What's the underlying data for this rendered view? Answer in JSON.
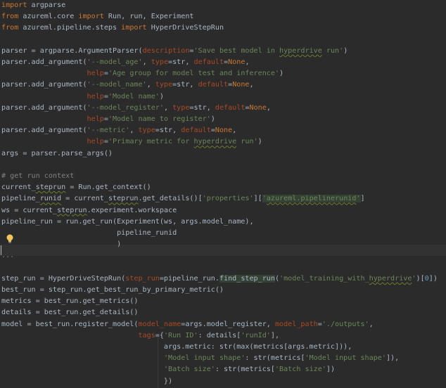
{
  "editor": {
    "lines": [
      [
        {
          "t": "import",
          "c": "kw"
        },
        {
          "t": " argparse",
          "c": "plain"
        }
      ],
      [
        {
          "t": "from",
          "c": "kw"
        },
        {
          "t": " azureml.core ",
          "c": "plain"
        },
        {
          "t": "import",
          "c": "kw"
        },
        {
          "t": " Run, run, Experiment",
          "c": "plain"
        }
      ],
      [
        {
          "t": "from",
          "c": "kw"
        },
        {
          "t": " azureml.pipeline.steps ",
          "c": "plain"
        },
        {
          "t": "import",
          "c": "kw"
        },
        {
          "t": " HyperDriveStepRun",
          "c": "plain"
        }
      ],
      [],
      [
        {
          "t": "parser = argparse.ArgumentParser(",
          "c": "plain"
        },
        {
          "t": "description",
          "c": "param"
        },
        {
          "t": "=",
          "c": "plain"
        },
        {
          "t": "'Save best model in ",
          "c": "str"
        },
        {
          "t": "hyperdrive",
          "c": "str squig"
        },
        {
          "t": " run'",
          "c": "str"
        },
        {
          "t": ")",
          "c": "plain"
        }
      ],
      [
        {
          "t": "parser.add_argument(",
          "c": "plain"
        },
        {
          "t": "'--model_age'",
          "c": "str"
        },
        {
          "t": ", ",
          "c": "plain"
        },
        {
          "t": "type",
          "c": "param"
        },
        {
          "t": "=str, ",
          "c": "plain"
        },
        {
          "t": "default",
          "c": "param"
        },
        {
          "t": "=",
          "c": "plain"
        },
        {
          "t": "None",
          "c": "kw"
        },
        {
          "t": ",",
          "c": "plain"
        }
      ],
      [
        {
          "t": "                    ",
          "c": "plain"
        },
        {
          "t": "help",
          "c": "param"
        },
        {
          "t": "=",
          "c": "plain"
        },
        {
          "t": "'Age group for model test and inference'",
          "c": "str"
        },
        {
          "t": ")",
          "c": "plain"
        }
      ],
      [
        {
          "t": "parser.add_argument(",
          "c": "plain"
        },
        {
          "t": "'--model_name'",
          "c": "str"
        },
        {
          "t": ", ",
          "c": "plain"
        },
        {
          "t": "type",
          "c": "param"
        },
        {
          "t": "=str, ",
          "c": "plain"
        },
        {
          "t": "default",
          "c": "param"
        },
        {
          "t": "=",
          "c": "plain"
        },
        {
          "t": "None",
          "c": "kw"
        },
        {
          "t": ",",
          "c": "plain"
        }
      ],
      [
        {
          "t": "                    ",
          "c": "plain"
        },
        {
          "t": "help",
          "c": "param"
        },
        {
          "t": "=",
          "c": "plain"
        },
        {
          "t": "'Model name'",
          "c": "str"
        },
        {
          "t": ")",
          "c": "plain"
        }
      ],
      [
        {
          "t": "parser.add_argument(",
          "c": "plain"
        },
        {
          "t": "'--model_register'",
          "c": "str"
        },
        {
          "t": ", ",
          "c": "plain"
        },
        {
          "t": "type",
          "c": "param"
        },
        {
          "t": "=str, ",
          "c": "plain"
        },
        {
          "t": "default",
          "c": "param"
        },
        {
          "t": "=",
          "c": "plain"
        },
        {
          "t": "None",
          "c": "kw"
        },
        {
          "t": ",",
          "c": "plain"
        }
      ],
      [
        {
          "t": "                    ",
          "c": "plain"
        },
        {
          "t": "help",
          "c": "param"
        },
        {
          "t": "=",
          "c": "plain"
        },
        {
          "t": "'Model name to register'",
          "c": "str"
        },
        {
          "t": ")",
          "c": "plain"
        }
      ],
      [
        {
          "t": "parser.add_argument(",
          "c": "plain"
        },
        {
          "t": "'--metric'",
          "c": "str"
        },
        {
          "t": ", ",
          "c": "plain"
        },
        {
          "t": "type",
          "c": "param"
        },
        {
          "t": "=str, ",
          "c": "plain"
        },
        {
          "t": "default",
          "c": "param"
        },
        {
          "t": "=",
          "c": "plain"
        },
        {
          "t": "None",
          "c": "kw"
        },
        {
          "t": ",",
          "c": "plain"
        }
      ],
      [
        {
          "t": "                    ",
          "c": "plain"
        },
        {
          "t": "help",
          "c": "param"
        },
        {
          "t": "=",
          "c": "plain"
        },
        {
          "t": "'Primary metric for ",
          "c": "str"
        },
        {
          "t": "hyperdrive",
          "c": "str squig"
        },
        {
          "t": " run'",
          "c": "str"
        },
        {
          "t": ")",
          "c": "plain"
        }
      ],
      [
        {
          "t": "args = parser.parse_args()",
          "c": "plain"
        }
      ],
      [],
      [
        {
          "t": "# get run context",
          "c": "cmt"
        }
      ],
      [
        {
          "t": "current_",
          "c": "plain"
        },
        {
          "t": "steprun",
          "c": "plain squig"
        },
        {
          "t": " = Run.get_context()",
          "c": "plain"
        }
      ],
      [
        {
          "t": "pipeline_",
          "c": "plain"
        },
        {
          "t": "runid",
          "c": "plain squig"
        },
        {
          "t": " = current_",
          "c": "plain"
        },
        {
          "t": "steprun",
          "c": "plain squig"
        },
        {
          "t": ".get_details()[",
          "c": "plain"
        },
        {
          "t": "'properties'",
          "c": "str"
        },
        {
          "t": "][",
          "c": "plain"
        },
        {
          "t": "'",
          "c": "str hl-bg"
        },
        {
          "t": "azureml.pipelinerunid",
          "c": "str hl-bg squig"
        },
        {
          "t": "'",
          "c": "str hl-bg"
        },
        {
          "t": "]",
          "c": "plain"
        }
      ],
      [
        {
          "t": "ws = current_",
          "c": "plain"
        },
        {
          "t": "steprun",
          "c": "plain squig"
        },
        {
          "t": ".experiment.workspace",
          "c": "plain"
        }
      ],
      [
        {
          "t": "pipeline_run = run.get_run(Experiment(ws, args.model_name),",
          "c": "plain"
        }
      ],
      [
        {
          "t": "                           pipeline_runid",
          "c": "plain"
        }
      ],
      [
        {
          "t": "                           )",
          "c": "plain"
        }
      ],
      [
        {
          "t": "...",
          "c": "cmt"
        }
      ],
      [],
      [
        {
          "t": "step_run = HyperDriveStepRun(",
          "c": "plain"
        },
        {
          "t": "step_run",
          "c": "param"
        },
        {
          "t": "=pipeline_run.",
          "c": "plain"
        },
        {
          "t": "find_step_run",
          "c": "plain hl-bg"
        },
        {
          "t": "(",
          "c": "plain"
        },
        {
          "t": "'model_training_with_",
          "c": "str"
        },
        {
          "t": "hyperdrive",
          "c": "str squig"
        },
        {
          "t": "'",
          "c": "str"
        },
        {
          "t": ")[",
          "c": "plain"
        },
        {
          "t": "0",
          "c": "num"
        },
        {
          "t": "])",
          "c": "plain"
        }
      ],
      [
        {
          "t": "best_run = step_run.get_best_run_by_primary_metric()",
          "c": "plain"
        }
      ],
      [
        {
          "t": "metrics = best_run.get_metrics()",
          "c": "plain"
        }
      ],
      [
        {
          "t": "details = best_run.get_details()",
          "c": "plain"
        }
      ],
      [
        {
          "t": "model = best_run.register_model(",
          "c": "plain"
        },
        {
          "t": "model_name",
          "c": "param"
        },
        {
          "t": "=args.model_register, ",
          "c": "plain"
        },
        {
          "t": "model_path",
          "c": "param"
        },
        {
          "t": "=",
          "c": "plain"
        },
        {
          "t": "'./outputs'",
          "c": "str"
        },
        {
          "t": ",",
          "c": "plain"
        }
      ],
      [
        {
          "t": "                                ",
          "c": "plain"
        },
        {
          "t": "tags",
          "c": "param"
        },
        {
          "t": "={",
          "c": "plain"
        },
        {
          "t": "'Run ID'",
          "c": "str"
        },
        {
          "t": ": details[",
          "c": "plain"
        },
        {
          "t": "'runId'",
          "c": "str"
        },
        {
          "t": "],",
          "c": "plain"
        }
      ],
      [
        {
          "t": "                                      args.metric: str(max(metrics[args.metric])),",
          "c": "plain"
        }
      ],
      [
        {
          "t": "                                      ",
          "c": "plain"
        },
        {
          "t": "'Model input shape'",
          "c": "str"
        },
        {
          "t": ": str(metrics[",
          "c": "plain"
        },
        {
          "t": "'Model input shape'",
          "c": "str"
        },
        {
          "t": "]),",
          "c": "plain"
        }
      ],
      [
        {
          "t": "                                      ",
          "c": "plain"
        },
        {
          "t": "'Batch size'",
          "c": "str"
        },
        {
          "t": ": str(metrics[",
          "c": "plain"
        },
        {
          "t": "'Batch size'",
          "c": "str"
        },
        {
          "t": "])",
          "c": "plain"
        }
      ],
      [
        {
          "t": "                                      })",
          "c": "plain"
        }
      ]
    ]
  },
  "intention_icon": "lightbulb-icon",
  "colors": {
    "background": "#2b2b2b",
    "keyword": "#cc7832",
    "string": "#6a8759",
    "parameter": "#aa4926",
    "number": "#6897bb",
    "comment": "#808080",
    "text": "#a9b7c6"
  }
}
